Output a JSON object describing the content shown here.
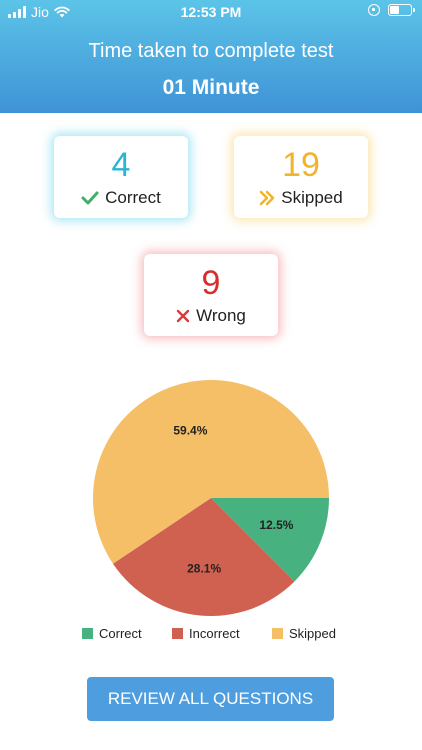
{
  "status_bar": {
    "carrier": "Jio",
    "time": "12:53 PM"
  },
  "header": {
    "title": "Time taken to complete test",
    "value": "01 Minute"
  },
  "cards": {
    "correct": {
      "count": "4",
      "label": "Correct"
    },
    "skipped": {
      "count": "19",
      "label": "Skipped"
    },
    "wrong": {
      "count": "9",
      "label": "Wrong"
    }
  },
  "colors": {
    "correct": "#47b27f",
    "incorrect": "#d06150",
    "skipped": "#f4bf66"
  },
  "chart_data": {
    "type": "pie",
    "categories": [
      "Correct",
      "Incorrect",
      "Skipped"
    ],
    "values": [
      12.5,
      28.1,
      59.4
    ],
    "labels": [
      "12.5%",
      "28.1%",
      "59.4%"
    ],
    "legend": [
      "Correct",
      "Incorrect",
      "Skipped"
    ],
    "legend_position": "bottom"
  },
  "review_button": {
    "label": "REVIEW ALL QUESTIONS"
  }
}
